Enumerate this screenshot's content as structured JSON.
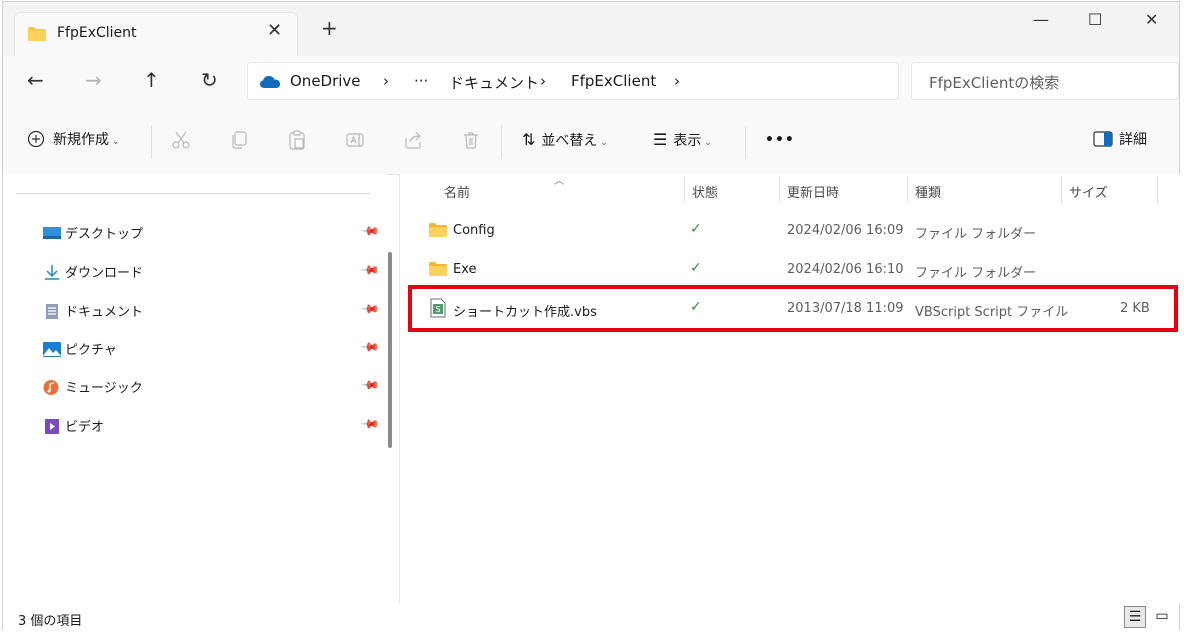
{
  "tab": {
    "title": "FfpExClient",
    "close": "✕",
    "new_tab": "+"
  },
  "window_controls": {
    "minimize": "—",
    "maximize": "☐",
    "close": "✕"
  },
  "nav": {
    "back": "←",
    "forward": "→",
    "up": "↑",
    "refresh": "↻"
  },
  "address": {
    "crumbs": [
      "OneDrive",
      "ドキュメント",
      "FfpExClient"
    ],
    "separator": "›",
    "overflow": "···"
  },
  "search": {
    "placeholder": "FfpExClientの検索"
  },
  "toolbar": {
    "new_label": "新規作成",
    "sort_label": "並べ替え",
    "view_label": "表示",
    "more_label": "•••",
    "details_label": "詳細"
  },
  "sidebar": {
    "items": [
      {
        "label": "デスクトップ",
        "icon": "desktop-icon"
      },
      {
        "label": "ダウンロード",
        "icon": "download-icon"
      },
      {
        "label": "ドキュメント",
        "icon": "documents-icon"
      },
      {
        "label": "ピクチャ",
        "icon": "pictures-icon"
      },
      {
        "label": "ミュージック",
        "icon": "music-icon"
      },
      {
        "label": "ビデオ",
        "icon": "video-icon"
      }
    ]
  },
  "columns": {
    "name": "名前",
    "status": "状態",
    "modified": "更新日時",
    "type": "種類",
    "size": "サイズ"
  },
  "files": [
    {
      "name": "Config",
      "status": "✓",
      "modified": "2024/02/06 16:09",
      "type": "ファイル フォルダー",
      "size": "",
      "icon": "folder-icon"
    },
    {
      "name": "Exe",
      "status": "✓",
      "modified": "2024/02/06 16:10",
      "type": "ファイル フォルダー",
      "size": "",
      "icon": "folder-icon"
    },
    {
      "name": "ショートカット作成.vbs",
      "status": "✓",
      "modified": "2013/07/18 11:09",
      "type": "VBScript Script ファイル",
      "size": "2 KB",
      "icon": "vbs-file-icon"
    }
  ],
  "statusbar": {
    "count": "3 個の項目"
  },
  "colors": {
    "highlight": "#e60012",
    "folder": "#f7c948",
    "sync_ok": "#2f8a3b",
    "onedrive": "#0f6cbd"
  }
}
